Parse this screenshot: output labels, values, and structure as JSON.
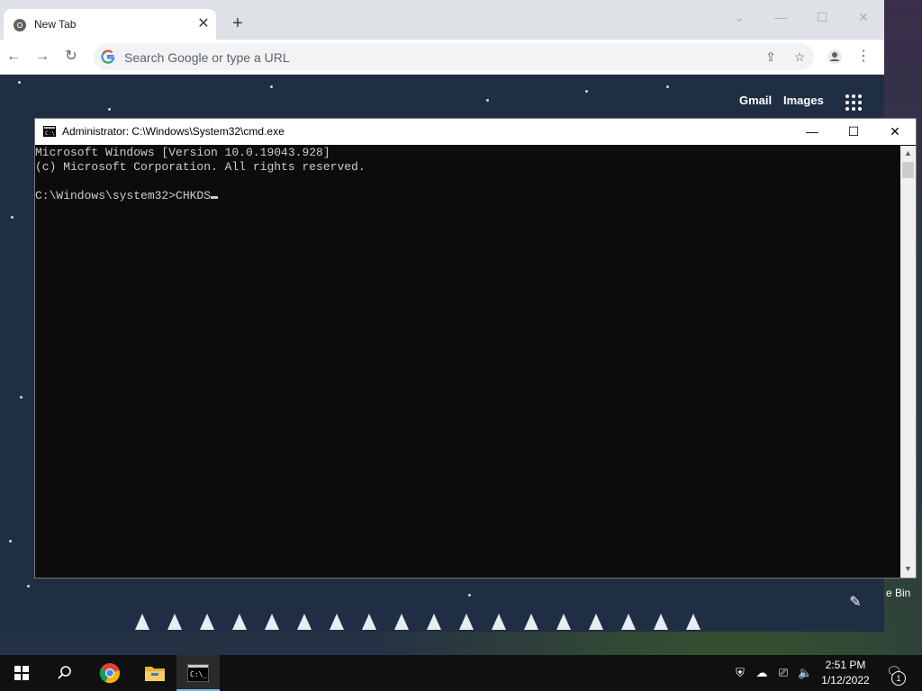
{
  "desktop": {
    "recycle_bin_label": "e Bin"
  },
  "chrome": {
    "tab": {
      "title": "New Tab"
    },
    "omnibox": {
      "placeholder": "Search Google or type a URL",
      "value": ""
    },
    "ntp": {
      "gmail": "Gmail",
      "images": "Images"
    }
  },
  "cmd": {
    "title": "Administrator: C:\\Windows\\System32\\cmd.exe",
    "lines": [
      "Microsoft Windows [Version 10.0.19043.928]",
      "(c) Microsoft Corporation. All rights reserved.",
      "",
      "C:\\Windows\\system32>CHKDS"
    ]
  },
  "taskbar": {
    "time": "2:51 PM",
    "date": "1/12/2022",
    "notification_count": "1"
  },
  "icons": {
    "start": "windows-logo",
    "search": "search-icon",
    "chrome": "chrome-icon",
    "explorer": "folder-icon",
    "cmd": "terminal-icon"
  }
}
